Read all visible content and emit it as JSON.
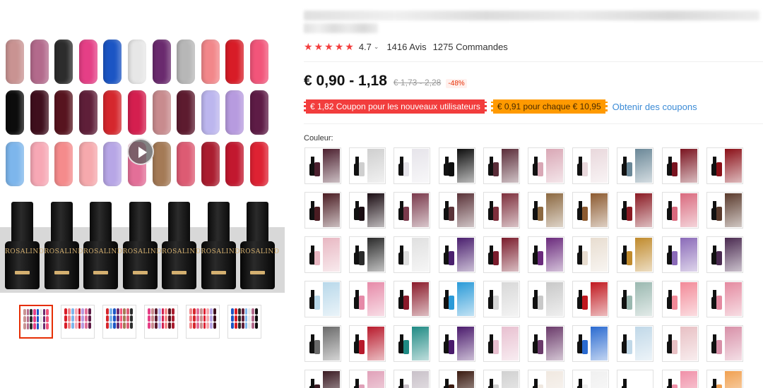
{
  "gallery": {
    "swatch_rows": [
      [
        "#c99392",
        "#b36a8c",
        "#2c2c2c",
        "#e53f86",
        "#1b55c4",
        "#e7e7e7",
        "#6a2a6e",
        "#b7b7b7",
        "#f2878a",
        "#d81c27",
        "#f2557a"
      ],
      [
        "#0c0c0c",
        "#3f0f1d",
        "#57141f",
        "#5f1f39",
        "#d5272d",
        "#d41f4f",
        "#c88b8e",
        "#5d1b2f",
        "#bcb6ee",
        "#b79bdf",
        "#5e1c46"
      ],
      [
        "#7db6ec",
        "#f7a8b5",
        "#f58b8c",
        "#f6a9ad",
        "#b7a6e6",
        "#e36f98",
        "#a47a56",
        "#dd5b73",
        "#aa1d2f",
        "#c2182f",
        "#de2233"
      ]
    ],
    "bottle_count": 7,
    "bottle_brand": "ROSALIND",
    "thumbnails": [
      {
        "name": "thumb-1",
        "active": true,
        "colors": [
          "#c99392",
          "#b36a8c",
          "#2c2c2c",
          "#e53f86",
          "#1b55c4",
          "#e7e7e7",
          "#6a2a6e",
          "#f2557a"
        ]
      },
      {
        "name": "thumb-2",
        "active": false,
        "colors": [
          "#d81c27",
          "#f2878a",
          "#7db6ec",
          "#f7a8b5",
          "#c2182f",
          "#b79bdf",
          "#e36f98",
          "#5e1c46"
        ]
      },
      {
        "name": "thumb-3",
        "active": false,
        "colors": [
          "#d5272d",
          "#7db6ec",
          "#1b55c4",
          "#6a2a6e",
          "#f2557a",
          "#a47a56",
          "#dd5b73",
          "#2c2c2c"
        ]
      },
      {
        "name": "thumb-4",
        "active": false,
        "colors": [
          "#e53f86",
          "#c88b8e",
          "#5d1b2f",
          "#bcb6ee",
          "#d41f4f",
          "#f58b8c",
          "#57141f",
          "#aa1d2f"
        ]
      },
      {
        "name": "thumb-5",
        "active": false,
        "colors": [
          "#f2878a",
          "#d5272d",
          "#e36f98",
          "#c99392",
          "#de2233",
          "#f6a9ad",
          "#b7a6e6",
          "#3f0f1d"
        ]
      },
      {
        "name": "thumb-6",
        "active": false,
        "colors": [
          "#1b55c4",
          "#d81c27",
          "#2c2c2c",
          "#5f1f39",
          "#7db6ec",
          "#e7e7e7",
          "#b36a8c",
          "#0c0c0c"
        ]
      }
    ]
  },
  "product": {
    "rating_value": "4.7",
    "review_count": "1416 Avis",
    "order_count": "1275 Commandes",
    "price": "€ 0,90 - 1,18",
    "original_price": "€ 1,73 - 2,28",
    "discount": "-48%",
    "coupon_new_users": "€ 1,82 Coupon pour les nouveaux utilisateurs",
    "coupon_store": "€ 0,91 pour chaque € 10,95",
    "coupon_link": "Obtenir des coupons",
    "color_label": "Couleur:"
  },
  "colors": {
    "accent_red": "#f23d3d",
    "accent_orange": "#ff9a00",
    "link_blue": "#3b8bd6"
  },
  "color_options": [
    [
      "#4b1f2e",
      "#cfcfcf",
      "#e6e4ea",
      "#0d0d0d",
      "#5a2c38",
      "#d9a7b5",
      "#e9d8dc",
      "#6a8797",
      "#7a1420",
      "#8a0f17"
    ],
    [
      "#4a1c22",
      "#1a0c12",
      "#7a3a4c",
      "#5a3238",
      "#7d2f3c",
      "#8b6840",
      "#8c5a30",
      "#8a1a23",
      "#d96a7e",
      "#5a3a2c"
    ],
    [
      "#e8b7c2",
      "#2a2a2a",
      "#e0e0e0",
      "#4a1f6e",
      "#7a1c2c",
      "#6a2a7c",
      "#e8ddd0",
      "#c08a2c",
      "#8a6ab8",
      "#4a2a50"
    ],
    [
      "#b8d8ea",
      "#e68aa8",
      "#8a1a2a",
      "#2a9ad8",
      "#d8d8d8",
      "#c8c8c8",
      "#c0181f",
      "#9ab8b0",
      "#f28a98",
      "#e48aa0"
    ],
    [
      "#6a6a6a",
      "#b81a2c",
      "#1f8a84",
      "#4a1a6c",
      "#e8c0d0",
      "#6a3a6a",
      "#2a6ad0",
      "#c0d8e8",
      "#e8c0c4",
      "#d890a8"
    ],
    [
      "#3a1a22",
      "#e0a0b8",
      "#c8c0c8",
      "#3a1a10",
      "#d0d0d0",
      "#f0e8e0",
      "#f0f0f0",
      "#ffffff",
      "#f090a8",
      "#f0a050"
    ]
  ]
}
